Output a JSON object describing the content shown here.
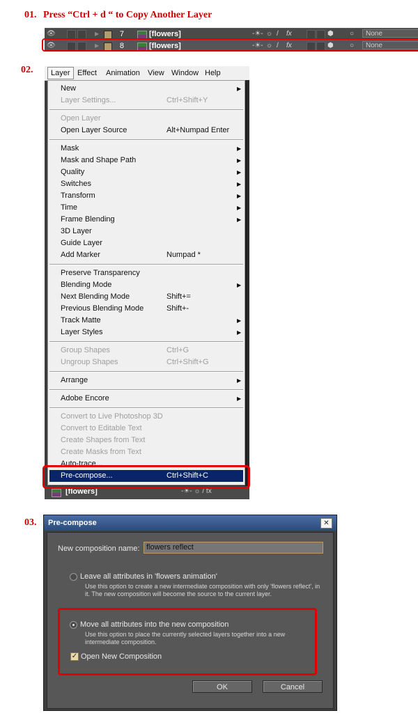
{
  "steps": {
    "one": {
      "num": "01.",
      "text": "Press “Ctrl + d “ to Copy Another Layer"
    },
    "two": {
      "num": "02."
    },
    "three": {
      "num": "03."
    }
  },
  "layers": [
    {
      "number": "7",
      "name": "[flowers]",
      "parent": "None",
      "selected": false
    },
    {
      "number": "8",
      "name": "[flowers]",
      "parent": "None",
      "selected": true
    }
  ],
  "switch_glyphs": {
    "shy": "-☀-",
    "collapse": "☼",
    "quality": "/",
    "effects": "fx",
    "motion": "○"
  },
  "menubar": [
    "Layer",
    "Effect",
    "Animation",
    "View",
    "Window",
    "Help"
  ],
  "menu_groups": [
    [
      {
        "label": "New",
        "shortcut": "",
        "submenu": true,
        "disabled": false
      },
      {
        "label": "Layer Settings...",
        "shortcut": "Ctrl+Shift+Y",
        "submenu": false,
        "disabled": true
      }
    ],
    [
      {
        "label": "Open Layer",
        "shortcut": "",
        "submenu": false,
        "disabled": true
      },
      {
        "label": "Open Layer Source",
        "shortcut": "Alt+Numpad Enter",
        "submenu": false,
        "disabled": false
      }
    ],
    [
      {
        "label": "Mask",
        "shortcut": "",
        "submenu": true,
        "disabled": false
      },
      {
        "label": "Mask and Shape Path",
        "shortcut": "",
        "submenu": true,
        "disabled": false
      },
      {
        "label": "Quality",
        "shortcut": "",
        "submenu": true,
        "disabled": false
      },
      {
        "label": "Switches",
        "shortcut": "",
        "submenu": true,
        "disabled": false
      },
      {
        "label": "Transform",
        "shortcut": "",
        "submenu": true,
        "disabled": false
      },
      {
        "label": "Time",
        "shortcut": "",
        "submenu": true,
        "disabled": false
      },
      {
        "label": "Frame Blending",
        "shortcut": "",
        "submenu": true,
        "disabled": false
      },
      {
        "label": "3D Layer",
        "shortcut": "",
        "submenu": false,
        "disabled": false
      },
      {
        "label": "Guide Layer",
        "shortcut": "",
        "submenu": false,
        "disabled": false
      },
      {
        "label": "Add Marker",
        "shortcut": "Numpad *",
        "submenu": false,
        "disabled": false
      }
    ],
    [
      {
        "label": "Preserve Transparency",
        "shortcut": "",
        "submenu": false,
        "disabled": false
      },
      {
        "label": "Blending Mode",
        "shortcut": "",
        "submenu": true,
        "disabled": false
      },
      {
        "label": "Next Blending Mode",
        "shortcut": "Shift+=",
        "submenu": false,
        "disabled": false
      },
      {
        "label": "Previous Blending Mode",
        "shortcut": "Shift+-",
        "submenu": false,
        "disabled": false
      },
      {
        "label": "Track Matte",
        "shortcut": "",
        "submenu": true,
        "disabled": false
      },
      {
        "label": "Layer Styles",
        "shortcut": "",
        "submenu": true,
        "disabled": false
      }
    ],
    [
      {
        "label": "Group Shapes",
        "shortcut": "Ctrl+G",
        "submenu": false,
        "disabled": true
      },
      {
        "label": "Ungroup Shapes",
        "shortcut": "Ctrl+Shift+G",
        "submenu": false,
        "disabled": true
      }
    ],
    [
      {
        "label": "Arrange",
        "shortcut": "",
        "submenu": true,
        "disabled": false
      }
    ],
    [
      {
        "label": "Adobe Encore",
        "shortcut": "",
        "submenu": true,
        "disabled": false
      }
    ],
    [
      {
        "label": "Convert to Live Photoshop 3D",
        "shortcut": "",
        "submenu": false,
        "disabled": true
      },
      {
        "label": "Convert to Editable Text",
        "shortcut": "",
        "submenu": false,
        "disabled": true
      },
      {
        "label": "Create Shapes from Text",
        "shortcut": "",
        "submenu": false,
        "disabled": true
      },
      {
        "label": "Create Masks from Text",
        "shortcut": "",
        "submenu": false,
        "disabled": true
      },
      {
        "label": "Auto-trace...",
        "shortcut": "",
        "submenu": false,
        "disabled": false
      },
      {
        "label": "Pre-compose...",
        "shortcut": "Ctrl+Shift+C",
        "submenu": false,
        "disabled": false,
        "highlighted": true
      }
    ]
  ],
  "menu_bottom_layer": "[flowers]",
  "dialog": {
    "title": "Pre-compose",
    "close": "✕",
    "name_label": "New composition name:",
    "name_value": "flowers reflect",
    "option1": {
      "label": "Leave all attributes in 'flowers animation'",
      "desc": "Use this option to create a new intermediate composition with only 'flowers reflect', in it. The new composition will become the source to the current layer.",
      "selected": false
    },
    "option2": {
      "label": "Move all attributes into the new composition",
      "desc": "Use this option to place the currently selected layers together into a new intermediate composition.",
      "selected": true
    },
    "open_new": {
      "label": "Open New Composition",
      "checked": true
    },
    "ok": "OK",
    "cancel": "Cancel"
  },
  "colors": {
    "highlight_red": "#e00000",
    "step_red": "#cc0000",
    "menu_selection": "#0a246a",
    "label_tan": "#b39c6d"
  }
}
